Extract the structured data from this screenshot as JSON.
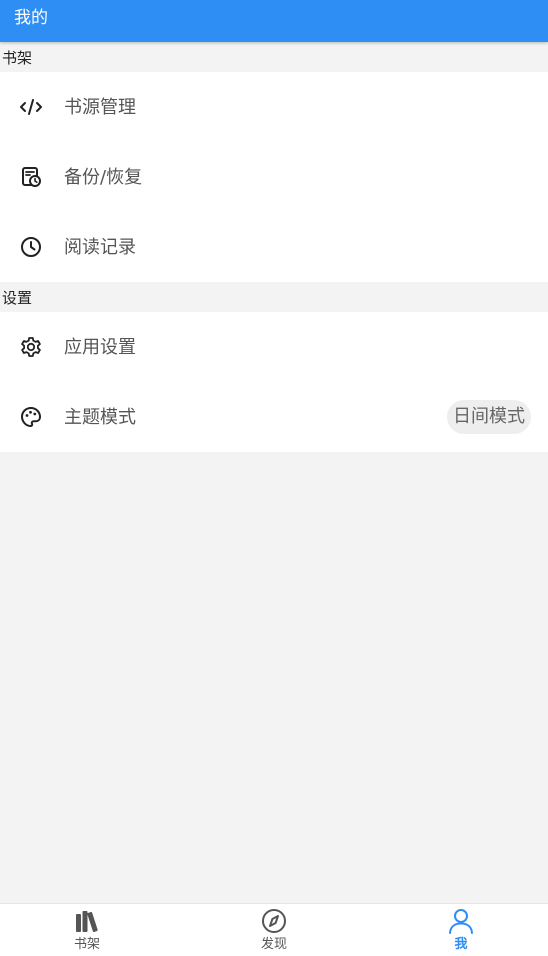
{
  "appbar": {
    "title": "我的"
  },
  "sections": {
    "bookshelf": {
      "header": "书架",
      "items": [
        {
          "label": "书源管理",
          "icon": "code-icon"
        },
        {
          "label": "备份/恢复",
          "icon": "backup-restore-icon"
        },
        {
          "label": "阅读记录",
          "icon": "clock-icon"
        }
      ]
    },
    "settings": {
      "header": "设置",
      "items": [
        {
          "label": "应用设置",
          "icon": "gear-icon"
        },
        {
          "label": "主题模式",
          "icon": "palette-icon",
          "value": "日间模式"
        }
      ]
    }
  },
  "bottom_nav": {
    "items": [
      {
        "label": "书架",
        "icon": "books-icon",
        "active": false
      },
      {
        "label": "发现",
        "icon": "compass-icon",
        "active": false
      },
      {
        "label": "我",
        "icon": "person-icon",
        "active": true
      }
    ]
  },
  "colors": {
    "primary": "#2f8ef4",
    "background": "#f3f3f3",
    "card": "#ffffff",
    "label": "#555555"
  }
}
